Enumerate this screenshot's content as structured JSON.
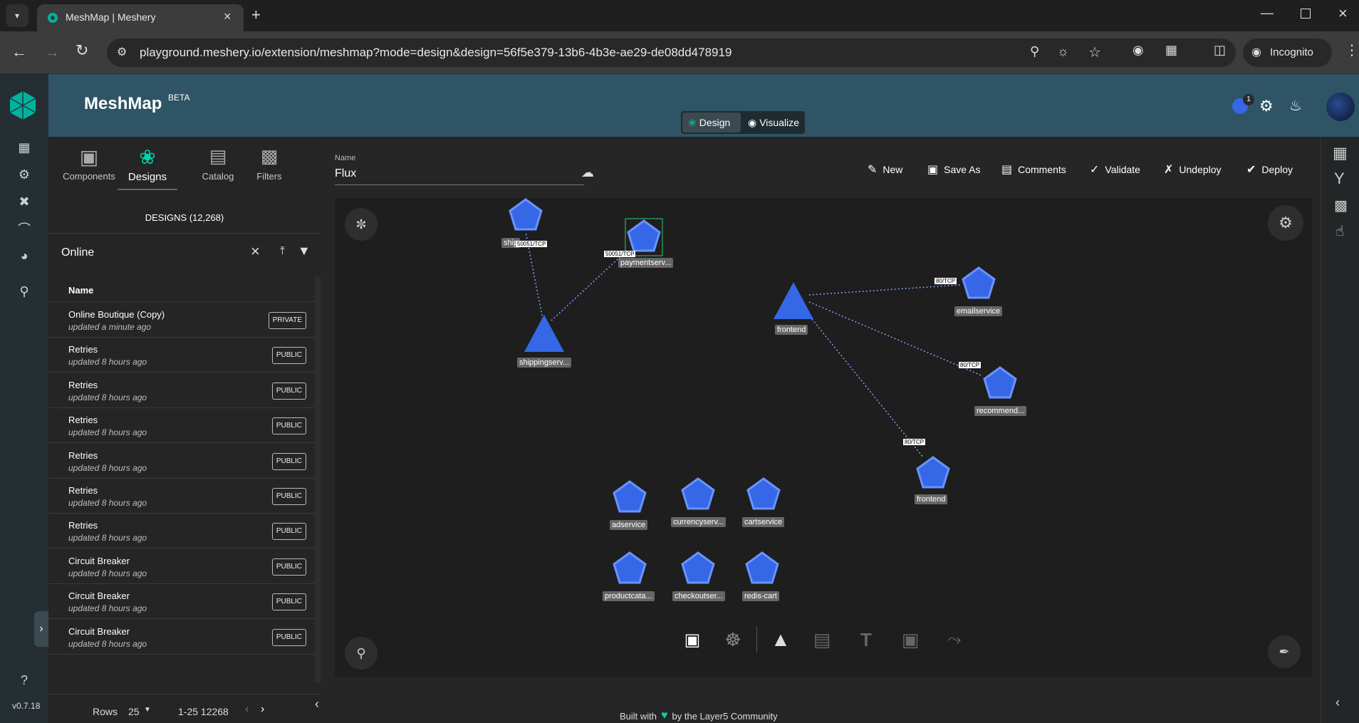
{
  "browser": {
    "tab_title": "MeshMap | Meshery",
    "url": "playground.meshery.io/extension/meshmap?mode=design&design=56f5e379-13b6-4b3e-ae29-de08dd478919",
    "incognito_label": "Incognito"
  },
  "header": {
    "brand": "MeshMap",
    "brand_sup": "BETA",
    "mode_design": "Design",
    "mode_visualize": "Visualize",
    "notification_count": "1"
  },
  "leftnav": {
    "version": "v0.7.18"
  },
  "sidepanel": {
    "tabs": [
      {
        "label": "Components",
        "icon": "components-icon"
      },
      {
        "label": "Designs",
        "icon": "designs-icon"
      },
      {
        "label": "Catalog",
        "icon": "catalog-icon"
      },
      {
        "label": "Filters",
        "icon": "filters-icon"
      }
    ],
    "designs_count_label": "DESIGNS (12,268)",
    "search_value": "Online",
    "column_name": "Name",
    "rows": [
      {
        "title": "Online Boutique (Copy)",
        "updated": "updated a minute ago",
        "visibility": "PRIVATE"
      },
      {
        "title": "Retries",
        "updated": "updated 8 hours ago",
        "visibility": "PUBLIC"
      },
      {
        "title": "Retries",
        "updated": "updated 8 hours ago",
        "visibility": "PUBLIC"
      },
      {
        "title": "Retries",
        "updated": "updated 8 hours ago",
        "visibility": "PUBLIC"
      },
      {
        "title": "Retries",
        "updated": "updated 8 hours ago",
        "visibility": "PUBLIC"
      },
      {
        "title": "Retries",
        "updated": "updated 8 hours ago",
        "visibility": "PUBLIC"
      },
      {
        "title": "Retries",
        "updated": "updated 8 hours ago",
        "visibility": "PUBLIC"
      },
      {
        "title": "Circuit Breaker",
        "updated": "updated 8 hours ago",
        "visibility": "PUBLIC"
      },
      {
        "title": "Circuit Breaker",
        "updated": "updated 8 hours ago",
        "visibility": "PUBLIC"
      },
      {
        "title": "Circuit Breaker",
        "updated": "updated 8 hours ago",
        "visibility": "PUBLIC"
      }
    ],
    "pagination": {
      "rows_label": "Rows",
      "rows_value": "25",
      "range": "1-25 12268"
    }
  },
  "toolbar": {
    "name_label": "Name",
    "name_value": "Flux",
    "new": "New",
    "save_as": "Save As",
    "comments": "Comments",
    "validate": "Validate",
    "undeploy": "Undeploy",
    "deploy": "Deploy"
  },
  "canvas": {
    "node_labels": {
      "ship": "ship",
      "paymentserv": "paymentserv...",
      "shippingserv": "shippingserv...",
      "frontend_main": "frontend",
      "emailservice": "emailservice",
      "recommend": "recommend...",
      "frontend_2": "frontend",
      "adservice": "adservice",
      "currencyserv": "currencyserv...",
      "cartservice": "cartservice",
      "productcata": "productcata...",
      "checkoutser": "checkoutser...",
      "redis_cart": "redis-cart"
    },
    "edge_labels": {
      "ship_edge": "50051/TCP",
      "payment_edge": "50051/TCP",
      "email_edge": "80/TCP",
      "recommend_edge": "80/TCP",
      "frontend2_edge": "80/TCP"
    }
  },
  "footer": {
    "built_with": "Built with",
    "by_community": "by the Layer5 Community"
  },
  "colors": {
    "header_bg": "#2f5465",
    "accent": "#00b39f",
    "node_fill": "#3567e6",
    "node_stroke": "#6a93ff"
  }
}
